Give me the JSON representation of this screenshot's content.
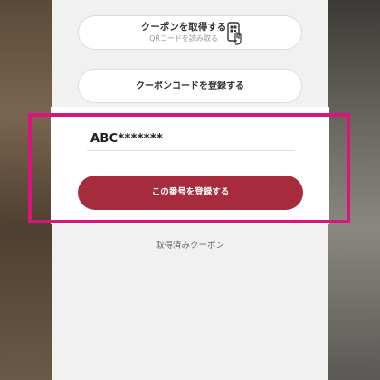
{
  "buttons": {
    "get_coupon_label": "クーポンを取得する",
    "get_coupon_sub": "QRコードを読み取る",
    "register_code_label": "クーポンコードを登録する",
    "submit_label": "この番号を登録する"
  },
  "code_input": {
    "value": "ABC*******"
  },
  "links": {
    "owned_coupons": "取得済みクーポン"
  },
  "icons": {
    "qr_scan": "qr-scan-phone-icon"
  },
  "colors": {
    "accent": "#a62b3c",
    "highlight": "#d8157d"
  }
}
